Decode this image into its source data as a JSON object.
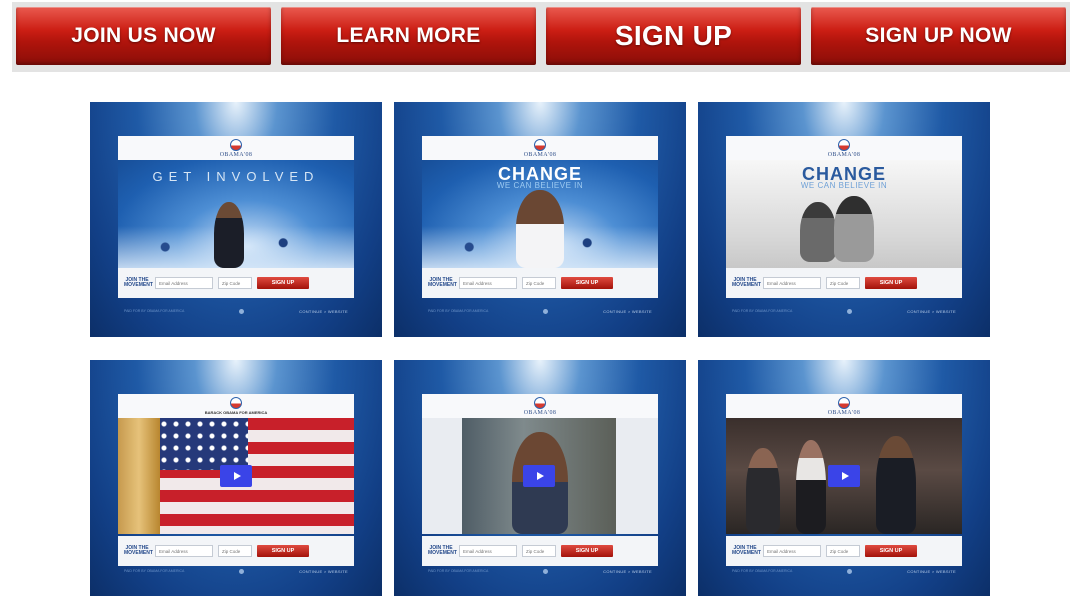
{
  "buttons": [
    {
      "label": "JOIN US NOW"
    },
    {
      "label": "LEARN MORE"
    },
    {
      "label": "SIGN UP"
    },
    {
      "label": "SIGN UP NOW"
    }
  ],
  "brand": "OBAMA'08",
  "banner_tagline": "BARACK OBAMA FOR AMERICA",
  "form": {
    "join_label_top": "JOIN THE",
    "join_label_bottom": "MOVEMENT",
    "email_placeholder": "Email Address",
    "zip_placeholder": "Zip Code",
    "signup_label": "SIGN UP"
  },
  "footer": {
    "left": "PAID FOR BY OBAMA FOR AMERICA",
    "right": "CONTINUE > WEBSITE"
  },
  "heroes": [
    {
      "title": "GET INVOLVED",
      "subtitle": ""
    },
    {
      "title": "CHANGE",
      "subtitle": "WE CAN BELIEVE IN"
    },
    {
      "title": "CHANGE",
      "subtitle": "WE CAN BELIEVE IN"
    }
  ],
  "colors": {
    "accent_red": "#c8170f",
    "brand_blue": "#1f5aa6",
    "play_blue": "#3a44e8"
  }
}
